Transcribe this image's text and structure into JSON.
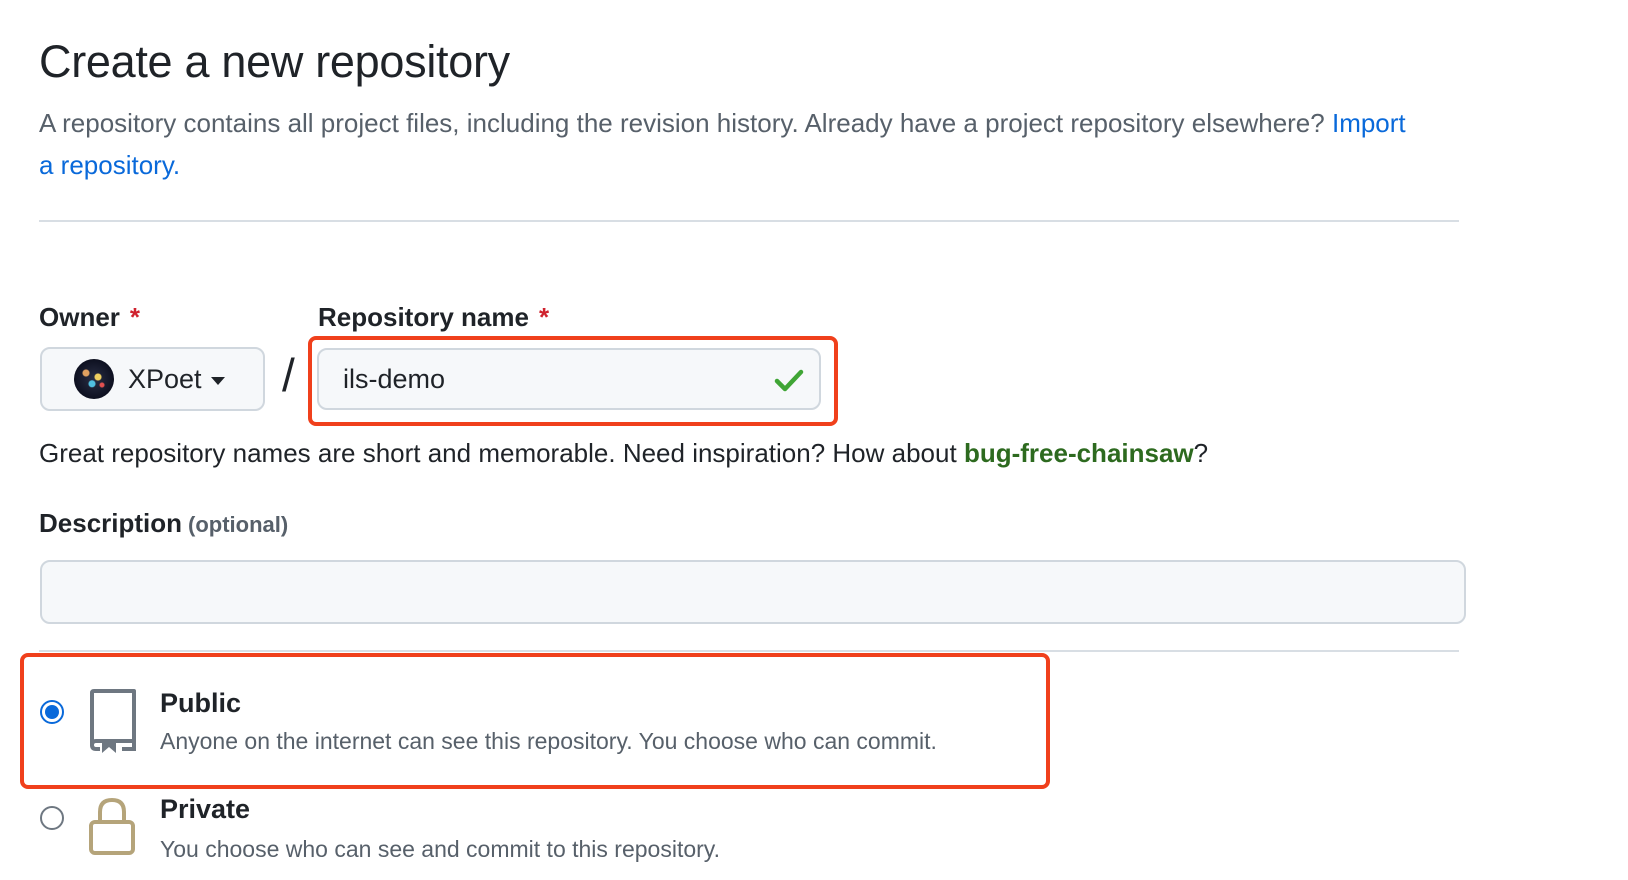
{
  "header": {
    "title": "Create a new repository",
    "intro_text": "A repository contains all project files, including the revision history. Already have a project repository elsewhere?",
    "import_link": "Import a repository."
  },
  "owner": {
    "label": "Owner",
    "required_mark": "*",
    "value": "XPoet",
    "avatar_icon": "user-avatar"
  },
  "separator": "/",
  "repo_name": {
    "label": "Repository name",
    "required_mark": "*",
    "value": "ils-demo",
    "status_icon": "check-icon",
    "status_color": "#2da44e"
  },
  "hint": {
    "text": "Great repository names are short and memorable. Need inspiration? How about",
    "suggestion": "bug-free-chainsaw",
    "suffix": "?"
  },
  "description": {
    "label": "Description",
    "optional": "(optional)",
    "value": ""
  },
  "visibility": {
    "options": [
      {
        "title": "Public",
        "description": "Anyone on the internet can see this repository. You choose who can commit.",
        "selected": true,
        "icon": "repo-icon"
      },
      {
        "title": "Private",
        "description": "You choose who can see and commit to this repository.",
        "selected": false,
        "icon": "lock-icon"
      }
    ]
  },
  "colors": {
    "highlight": "#f0401c",
    "link": "#0969da",
    "required": "#cf222e",
    "suggestion": "#2d6a1f"
  }
}
